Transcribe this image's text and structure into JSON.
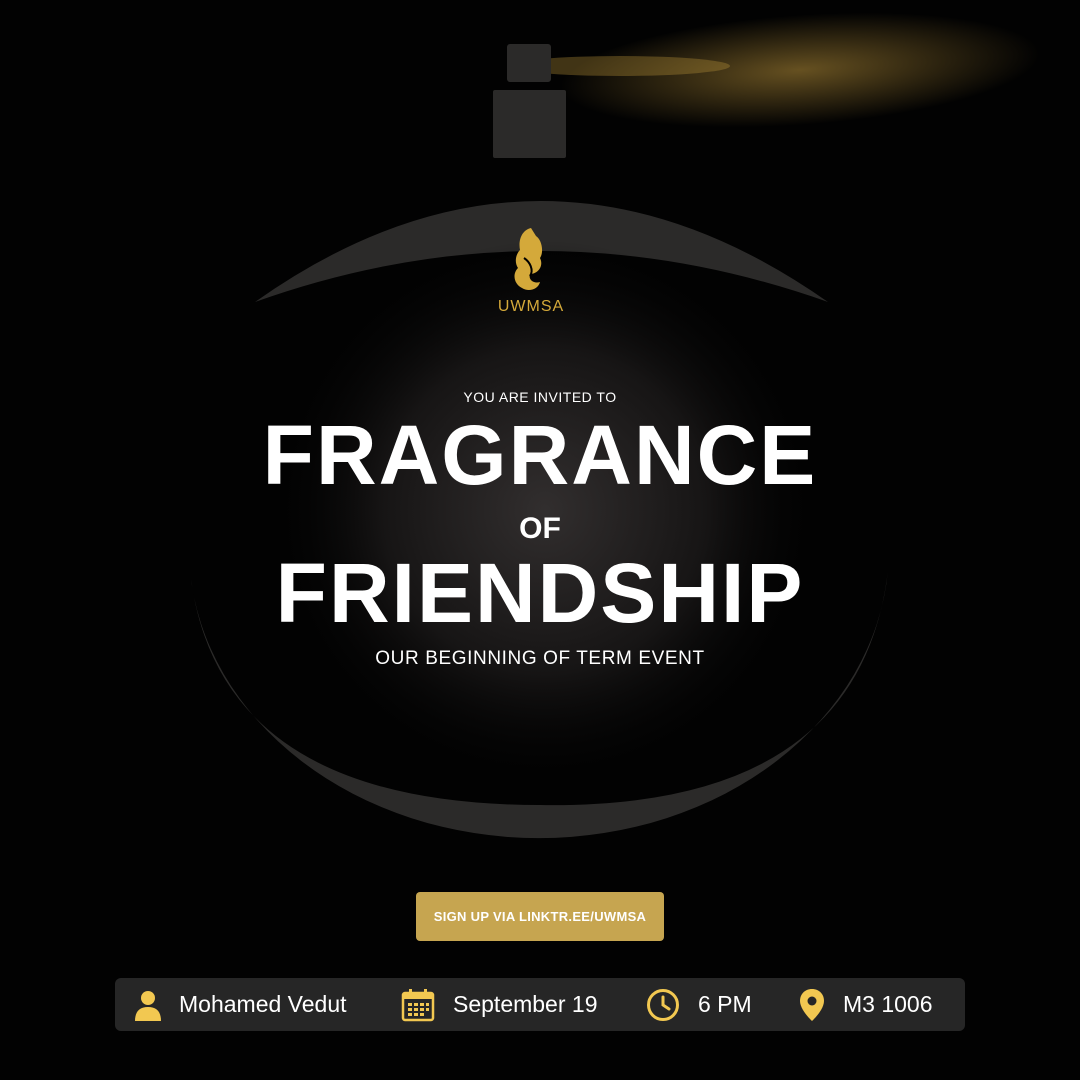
{
  "logo": {
    "wordmark": "UWMSA",
    "emblem": "horse-calligraphy-logo"
  },
  "invite": {
    "pretitle": "YOU ARE INVITED TO",
    "title_line1": "FRAGRANCE",
    "title_connector": "OF",
    "title_line2": "FRIENDSHIP",
    "subtitle": "OUR BEGINNING OF TERM EVENT"
  },
  "cta": {
    "label": "SIGN UP VIA LINKTR.EE/UWMSA"
  },
  "details": {
    "host": {
      "icon": "person-icon",
      "text": "Mohamed Vedut"
    },
    "date": {
      "icon": "calendar-icon",
      "text": "September 19"
    },
    "time": {
      "icon": "clock-icon",
      "text": "6 PM"
    },
    "location": {
      "icon": "map-pin-icon",
      "text": "M3 1006"
    }
  },
  "colors": {
    "accent_gold": "#c6a550",
    "icon_gold": "#f2c851",
    "bottle": "#2b2a29",
    "background": "#020202"
  }
}
